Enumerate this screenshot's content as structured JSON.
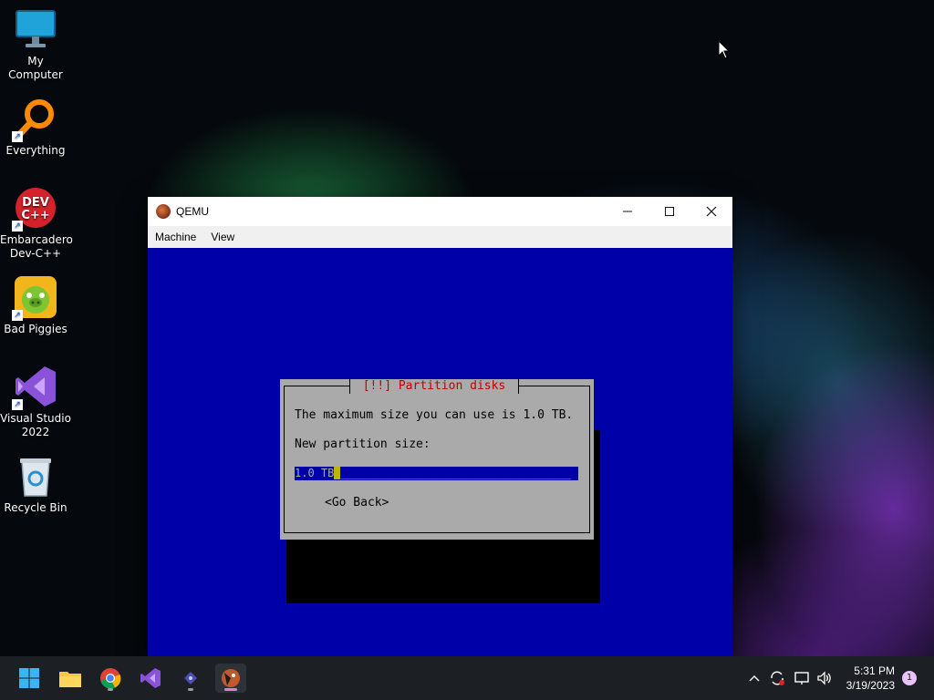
{
  "desktop": {
    "icons": [
      {
        "label_line1": "My Computer",
        "label_line2": ""
      },
      {
        "label_line1": "Everything",
        "label_line2": ""
      },
      {
        "label_line1": "Embarcadero",
        "label_line2": "Dev-C++"
      },
      {
        "label_line1": "Bad Piggies",
        "label_line2": ""
      },
      {
        "label_line1": "Visual Studio",
        "label_line2": "2022"
      },
      {
        "label_line1": "Recycle Bin",
        "label_line2": ""
      }
    ],
    "devcpp_icon_text_1": "DEV",
    "devcpp_icon_text_2": "C++"
  },
  "qemu": {
    "title": "QEMU",
    "menu": [
      "Machine",
      "View"
    ],
    "dialog": {
      "title": "[!!] Partition disks",
      "message": "The maximum size you can use is 1.0 TB.",
      "prompt": "New partition size:",
      "input_value": "1.0 TB",
      "input_fill": "___________________________________",
      "go_back": "<Go Back>"
    }
  },
  "taskbar": {
    "time": "5:31 PM",
    "date": "3/19/2023",
    "notification_count": "1"
  },
  "colors": {
    "qemu_bg": "#0000a8",
    "dialog_bg": "#aaaaaa",
    "dialog_title": "#c00000",
    "cursor": "#b8b800"
  }
}
